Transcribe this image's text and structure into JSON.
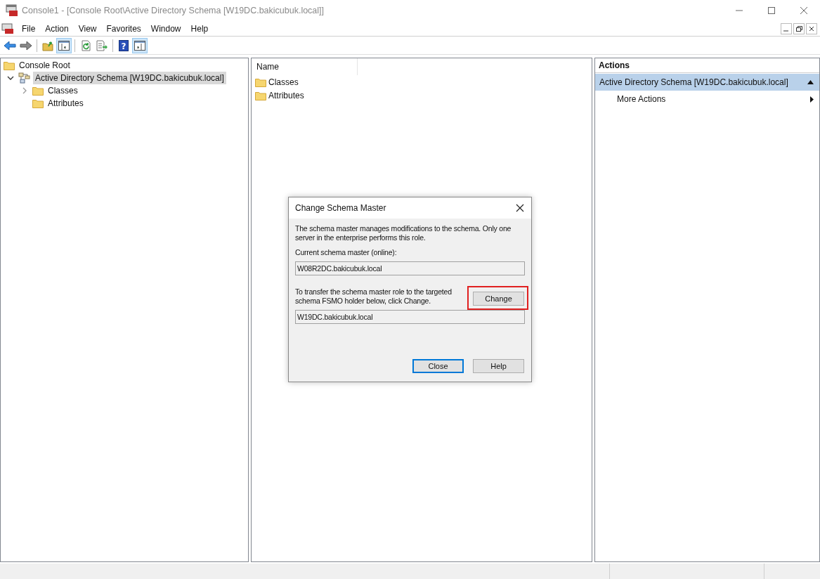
{
  "window": {
    "title": "Console1 - [Console Root\\Active Directory Schema [W19DC.bakicubuk.local]]"
  },
  "menu": [
    "File",
    "Action",
    "View",
    "Favorites",
    "Window",
    "Help"
  ],
  "toolbar": [
    {
      "kind": "back",
      "selected": false
    },
    {
      "kind": "forward",
      "selected": false
    },
    {
      "kind": "sep"
    },
    {
      "kind": "up",
      "selected": false
    },
    {
      "kind": "tree",
      "selected": true
    },
    {
      "kind": "sep"
    },
    {
      "kind": "refresh",
      "selected": false
    },
    {
      "kind": "export",
      "selected": false
    },
    {
      "kind": "sep"
    },
    {
      "kind": "help",
      "selected": false,
      "glyph": "?"
    },
    {
      "kind": "pane",
      "selected": true
    }
  ],
  "tree": [
    {
      "label": "Console Root",
      "kind": "folder",
      "selected": false,
      "children": [
        {
          "label": "Active Directory Schema [W19DC.bakicubuk.local]",
          "kind": "snapin",
          "selected": true,
          "expanded": true,
          "children": [
            {
              "label": "Classes",
              "kind": "folder",
              "selected": false,
              "expanded": false
            },
            {
              "label": "Attributes",
              "kind": "folder",
              "selected": false
            }
          ]
        }
      ]
    }
  ],
  "list": {
    "columns": [
      "Name"
    ],
    "items": [
      "Classes",
      "Attributes"
    ]
  },
  "actions": {
    "header": "Actions",
    "section": {
      "title": "Active Directory Schema [W19DC.bakicubuk.local]",
      "expanded": true
    },
    "items": [
      "More Actions"
    ]
  },
  "dialog": {
    "title": "Change Schema Master",
    "description": "The schema master manages modifications to the schema. Only one server in the enterprise performs this role.",
    "current_label": "Current schema master (online):",
    "current_value": "W08R2DC.bakicubuk.local",
    "transfer_text": "To transfer the schema master role to the targeted schema FSMO holder below, click Change.",
    "target_value": "W19DC.bakicubuk.local",
    "buttons": [
      {
        "label": "Change",
        "kind": "change",
        "highlighted": true,
        "default": false
      },
      {
        "label": "Close",
        "kind": "close",
        "highlighted": false,
        "default": true
      },
      {
        "label": "Help",
        "kind": "help",
        "highlighted": false,
        "default": false
      }
    ]
  }
}
